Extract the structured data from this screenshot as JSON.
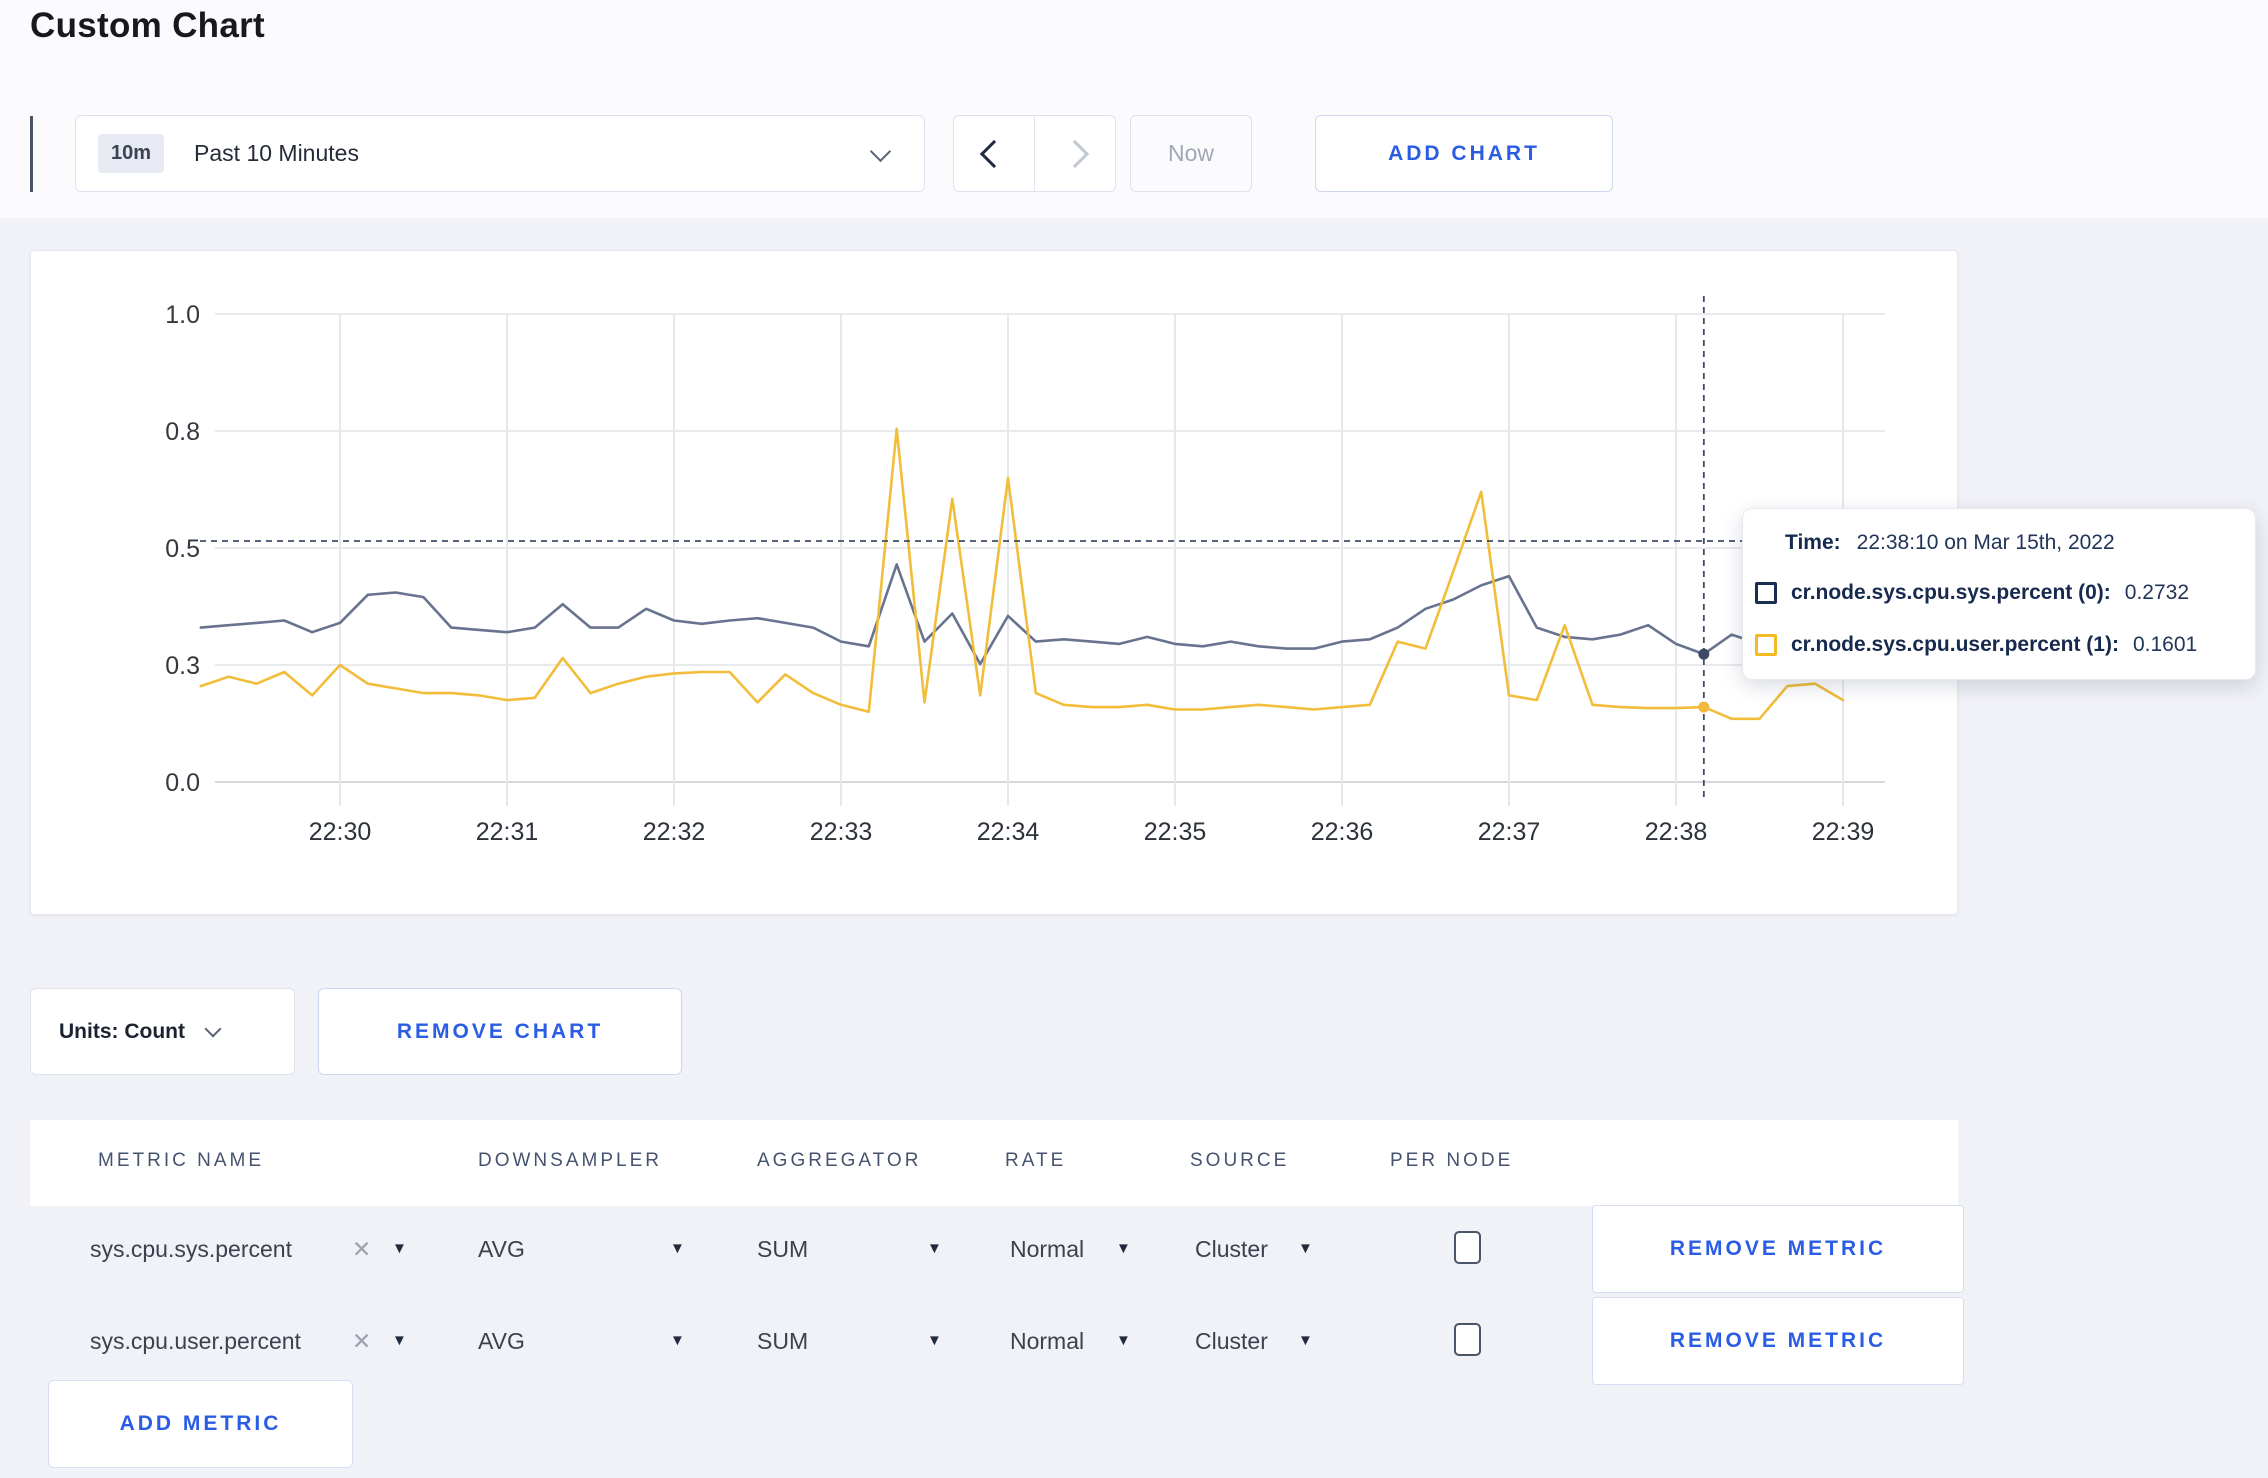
{
  "page": {
    "title": "Custom Chart"
  },
  "toolbar": {
    "time_badge": "10m",
    "time_label": "Past 10 Minutes",
    "now_label": "Now",
    "add_chart_label": "ADD CHART"
  },
  "chart_controls": {
    "units_label": "Units: Count",
    "remove_chart_label": "REMOVE CHART",
    "add_metric_label": "ADD METRIC"
  },
  "tooltip": {
    "time_label": "Time:",
    "time_value": "22:38:10 on Mar 15th, 2022",
    "series": [
      {
        "label": "cr.node.sys.cpu.sys.percent (0):",
        "value": "0.2732",
        "color": "#1c2d52"
      },
      {
        "label": "cr.node.sys.cpu.user.percent (1):",
        "value": "0.1601",
        "color": "#f5b921"
      }
    ]
  },
  "table": {
    "headers": [
      "METRIC NAME",
      "DOWNSAMPLER",
      "AGGREGATOR",
      "RATE",
      "SOURCE",
      "PER NODE"
    ],
    "rows": [
      {
        "metric": "sys.cpu.sys.percent",
        "remove_icon": "✕",
        "downsampler": "AVG",
        "aggregator": "SUM",
        "rate": "Normal",
        "source": "Cluster",
        "per_node_checked": false,
        "remove_label": "REMOVE METRIC"
      },
      {
        "metric": "sys.cpu.user.percent",
        "remove_icon": "✕",
        "downsampler": "AVG",
        "aggregator": "SUM",
        "rate": "Normal",
        "source": "Cluster",
        "per_node_checked": false,
        "remove_label": "REMOVE METRIC"
      }
    ]
  },
  "chart_data": {
    "type": "line",
    "title": "",
    "xlabel": "",
    "ylabel": "",
    "ylim": [
      0,
      1
    ],
    "grid": true,
    "legend_position": "tooltip-only",
    "x_start_time": "22:29:10",
    "x_step_seconds": 10,
    "x_ticks": [
      {
        "label": "22:30",
        "t": 50
      },
      {
        "label": "22:31",
        "t": 110
      },
      {
        "label": "22:32",
        "t": 170
      },
      {
        "label": "22:33",
        "t": 230
      },
      {
        "label": "22:34",
        "t": 290
      },
      {
        "label": "22:35",
        "t": 350
      },
      {
        "label": "22:36",
        "t": 410
      },
      {
        "label": "22:37",
        "t": 470
      },
      {
        "label": "22:38",
        "t": 530
      },
      {
        "label": "22:39",
        "t": 590
      }
    ],
    "y_ticks": [
      {
        "value": 0.0,
        "label": "0.0"
      },
      {
        "value": 0.25,
        "label": "0.3"
      },
      {
        "value": 0.5,
        "label": "0.5"
      },
      {
        "value": 0.75,
        "label": "0.8"
      },
      {
        "value": 1.0,
        "label": "1.0"
      }
    ],
    "series": [
      {
        "name": "cr.node.sys.cpu.sys.percent",
        "color": "#68738f",
        "values": [
          0.33,
          0.335,
          0.34,
          0.345,
          0.32,
          0.34,
          0.4,
          0.405,
          0.395,
          0.33,
          0.325,
          0.32,
          0.33,
          0.38,
          0.33,
          0.33,
          0.37,
          0.345,
          0.338,
          0.345,
          0.35,
          0.34,
          0.33,
          0.3,
          0.29,
          0.465,
          0.3,
          0.36,
          0.252,
          0.355,
          0.3,
          0.305,
          0.3,
          0.295,
          0.31,
          0.295,
          0.29,
          0.3,
          0.29,
          0.285,
          0.285,
          0.3,
          0.305,
          0.33,
          0.37,
          0.39,
          0.42,
          0.44,
          0.33,
          0.31,
          0.305,
          0.315,
          0.335,
          0.295,
          0.2732,
          0.315,
          0.295,
          0.3,
          0.295,
          0.3
        ]
      },
      {
        "name": "cr.node.sys.cpu.user.percent",
        "color": "#f2bd3a",
        "values": [
          0.205,
          0.225,
          0.21,
          0.235,
          0.185,
          0.25,
          0.21,
          0.2,
          0.19,
          0.19,
          0.185,
          0.175,
          0.18,
          0.265,
          0.19,
          0.21,
          0.225,
          0.232,
          0.235,
          0.235,
          0.17,
          0.23,
          0.19,
          0.165,
          0.15,
          0.755,
          0.17,
          0.605,
          0.185,
          0.65,
          0.19,
          0.165,
          0.16,
          0.16,
          0.165,
          0.155,
          0.155,
          0.16,
          0.165,
          0.16,
          0.155,
          0.16,
          0.165,
          0.3,
          0.285,
          0.45,
          0.62,
          0.185,
          0.175,
          0.335,
          0.165,
          0.16,
          0.158,
          0.158,
          0.1601,
          0.135,
          0.135,
          0.205,
          0.21,
          0.175
        ]
      }
    ],
    "crosshair": {
      "t": 540,
      "time": "22:38:10",
      "mouse_y_value": 0.515,
      "points": [
        {
          "series": 0,
          "value": 0.2732
        },
        {
          "series": 1,
          "value": 0.1601
        }
      ]
    }
  }
}
